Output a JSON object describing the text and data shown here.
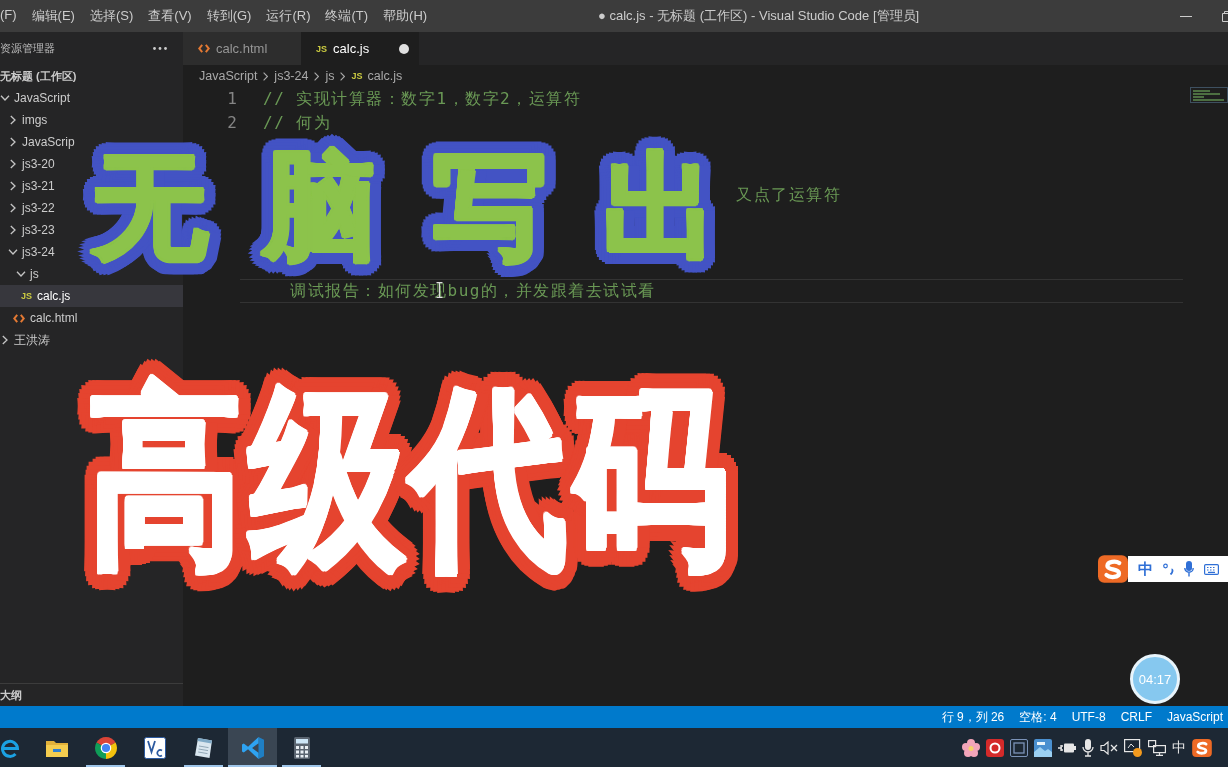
{
  "title_bar": {
    "menu": [
      "(F)",
      "编辑(E)",
      "选择(S)",
      "查看(V)",
      "转到(G)",
      "运行(R)",
      "终端(T)",
      "帮助(H)"
    ],
    "title": "● calc.js - 无标题 (工作区) - Visual Studio Code [管理员]"
  },
  "sidebar": {
    "title": "资源管理器",
    "workspace": "无标题 (工作区)",
    "tree": [
      {
        "label": "JavaScript",
        "kind": "folder",
        "expanded": true,
        "selected": false,
        "children": [
          {
            "label": "imgs",
            "kind": "folder",
            "expanded": false,
            "selected": false
          },
          {
            "label": "JavaScrip",
            "kind": "folder",
            "expanded": false,
            "selected": false
          },
          {
            "label": "js3-20",
            "kind": "folder",
            "expanded": false,
            "selected": false
          },
          {
            "label": "js3-21",
            "kind": "folder",
            "expanded": false,
            "selected": false
          },
          {
            "label": "js3-22",
            "kind": "folder",
            "expanded": false,
            "selected": false
          },
          {
            "label": "js3-23",
            "kind": "folder",
            "expanded": false,
            "selected": false
          },
          {
            "label": "js3-24",
            "kind": "folder",
            "expanded": true,
            "selected": false,
            "children": [
              {
                "label": "js",
                "kind": "folder",
                "expanded": true,
                "selected": false,
                "children": [
                  {
                    "label": "calc.js",
                    "kind": "js",
                    "badge": "JS",
                    "selected": true
                  }
                ]
              },
              {
                "label": "calc.html",
                "kind": "html",
                "selected": false
              }
            ]
          }
        ]
      },
      {
        "label": "王洪涛",
        "kind": "folder",
        "expanded": false,
        "selected": false
      }
    ],
    "outline": "大纲"
  },
  "tabs": [
    {
      "label": "calc.html",
      "kind": "html",
      "selected": false,
      "modified": false
    },
    {
      "label": "calc.js",
      "kind": "js",
      "badge": "JS",
      "selected": true,
      "modified": true
    }
  ],
  "breadcrumb": [
    {
      "label": "JavaScript",
      "kind": "folder"
    },
    {
      "label": "js3-24",
      "kind": "folder"
    },
    {
      "label": "js",
      "kind": "folder"
    },
    {
      "label": "calc.js",
      "kind": "js",
      "badge": "JS"
    }
  ],
  "code": {
    "lines": [
      {
        "number": "1",
        "text": "// 实现计算器：数字1，数字2，运算符",
        "current": false
      },
      {
        "number": "2",
        "text": "// 何为",
        "current": false
      },
      {
        "text": "又点了运算符",
        "current": false
      },
      {
        "text": "调试报告：如何发现bug的，并发跟着去试试看",
        "current": true
      }
    ]
  },
  "captions": [
    {
      "text": "无脑写出",
      "kind": "green"
    },
    {
      "text": "高级代码",
      "kind": "white"
    }
  ],
  "ime_toolbar": {
    "mode": "中"
  },
  "recording_timer": "04:17",
  "status_bar": [
    "行 9，列 26",
    "空格: 4",
    "UTF-8",
    "CRLF",
    "JavaScript"
  ],
  "taskbar": {
    "apps": [
      {
        "kind": "browser",
        "running": false,
        "selected": false
      },
      {
        "kind": "folder",
        "running": false,
        "selected": false
      },
      {
        "kind": "web",
        "running": true,
        "selected": false
      },
      {
        "kind": "remote",
        "running": false,
        "selected": false
      },
      {
        "kind": "notepad",
        "running": true,
        "selected": false
      },
      {
        "kind": "editor",
        "running": true,
        "selected": true
      },
      {
        "kind": "calculator",
        "running": true,
        "selected": false
      }
    ],
    "input_mode": "中"
  }
}
